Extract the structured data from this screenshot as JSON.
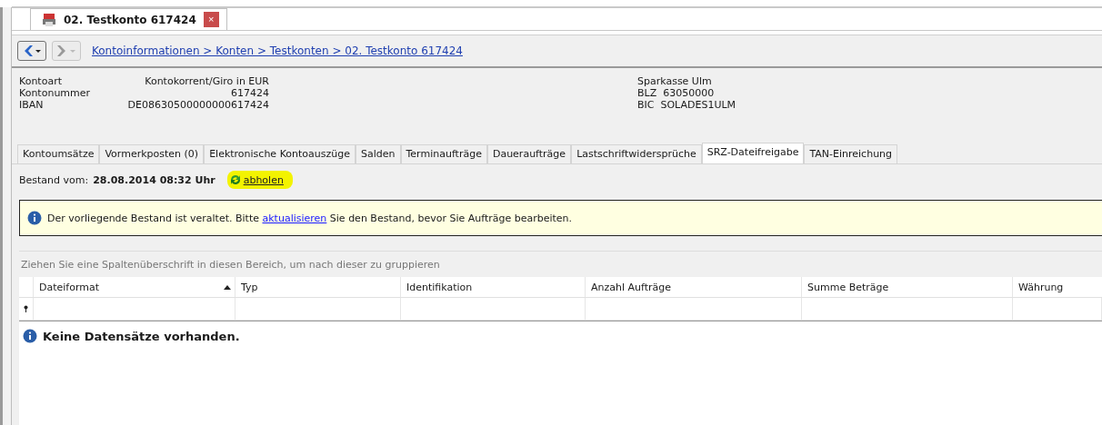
{
  "doc_tab": {
    "title": "02. Testkonto 617424",
    "close": "×",
    "selected": true
  },
  "breadcrumb": "Kontoinformationen > Konten > Testkonten > 02. Testkonto 617424",
  "account": {
    "left": [
      {
        "label": "Kontoart",
        "value": "Kontokorrent/Giro in EUR"
      },
      {
        "label": "Kontonummer",
        "value": "617424"
      },
      {
        "label": "IBAN",
        "value": "DE08630500000000617424"
      }
    ],
    "right": [
      "Sparkasse Ulm",
      "BLZ  63050000",
      "BIC  SOLADES1ULM"
    ]
  },
  "tabs": [
    {
      "label": "Kontoumsätze",
      "selected": false
    },
    {
      "label": "Vormerkposten (0)",
      "selected": false
    },
    {
      "label": "Elektronische Kontoauszüge",
      "selected": false
    },
    {
      "label": "Salden",
      "selected": false
    },
    {
      "label": "Terminaufträge",
      "selected": false
    },
    {
      "label": "Daueraufträge",
      "selected": false
    },
    {
      "label": "Lastschriftwidersprüche",
      "selected": false
    },
    {
      "label": "SRZ-Dateifreigabe",
      "selected": true
    },
    {
      "label": "TAN-Einreichung",
      "selected": false
    }
  ],
  "status": {
    "label": "Bestand vom:",
    "date": "28.08.2014 08:32 Uhr",
    "action": "abholen",
    "highlighted": true
  },
  "notice": {
    "before": "Der vorliegende Bestand ist veraltet. Bitte",
    "link": "aktualisieren",
    "after": "Sie den Bestand, bevor Sie Aufträge bearbeiten."
  },
  "group_hint": "Ziehen Sie eine Spaltenüberschrift in diesen Bereich, um nach dieser zu gruppieren",
  "table": {
    "columns": [
      {
        "label": "Dateiformat",
        "sorted": true
      },
      {
        "label": "Typ",
        "sorted": false
      },
      {
        "label": "Identifikation",
        "sorted": false
      },
      {
        "label": "Anzahl Aufträge",
        "sorted": false
      },
      {
        "label": "Summe Beträge",
        "sorted": false
      },
      {
        "label": "Währung",
        "sorted": false
      }
    ],
    "empty": "Keine Datensätze vorhanden."
  }
}
